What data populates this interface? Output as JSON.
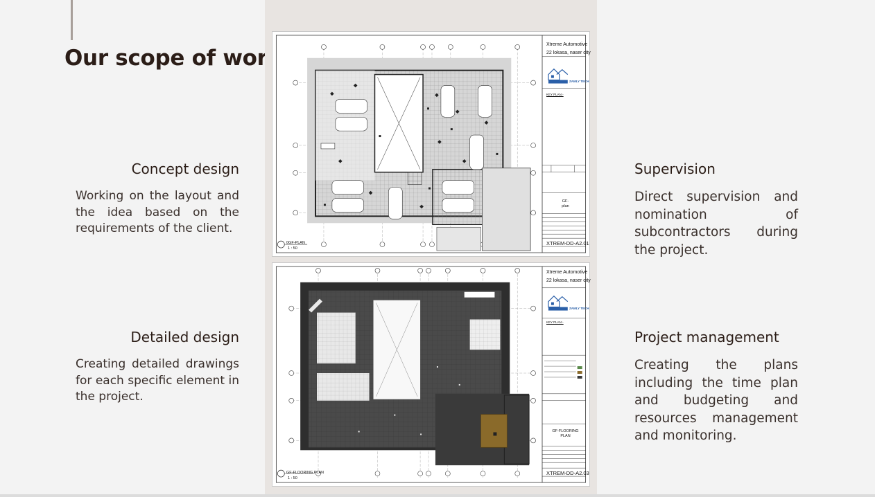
{
  "slide": {
    "title": "Our scope of work",
    "left": [
      {
        "heading": "Concept design",
        "text": "Working on the layout and the idea based on the requirements of the client."
      },
      {
        "heading": "Detailed design",
        "text": "Creating detailed drawings for each specific element in the project."
      }
    ],
    "right": [
      {
        "heading": "Supervision",
        "text": "Direct supervision and nomination of subcontractors during the project."
      },
      {
        "heading": "Project management",
        "text": "Creating the plans including the time plan and budgeting and resources management and monitoring."
      }
    ]
  },
  "drawings": [
    {
      "project_name": "Xtreme Automotive",
      "address": "22 lokasa, naser city",
      "logo_text": "ZAMLY TECH",
      "key_plan": "KEY PLAN:-",
      "sheet_name_1": "GF-",
      "sheet_name_2": "plan",
      "drawing_code": "XTREM-DD-A2.01",
      "view_label": "0GF-PLAN",
      "scale": "1 : 50"
    },
    {
      "project_name": "Xtreme Automotive",
      "address": "22 lokasa, naser city",
      "logo_text": "ZAMLY TECH",
      "key_plan": "KEY PLAN:-",
      "sheet_name_1": "GF-FLOORING",
      "sheet_name_2": "PLAN",
      "drawing_code": "XTREM-DD-A2.03",
      "view_label": "GF-FLOORING PLAN",
      "scale": "1 : 50"
    }
  ],
  "colors": {
    "title": "#2b1d17",
    "body_text": "#3a302c",
    "panel": "#e8e4e1",
    "accent_line": "#a89f9a",
    "floor_dark": "#4a4a4a",
    "highlight": "#8a6a2a",
    "logo_blue": "#2a5fa8"
  },
  "icons": {
    "logo": "house-logo-icon"
  }
}
